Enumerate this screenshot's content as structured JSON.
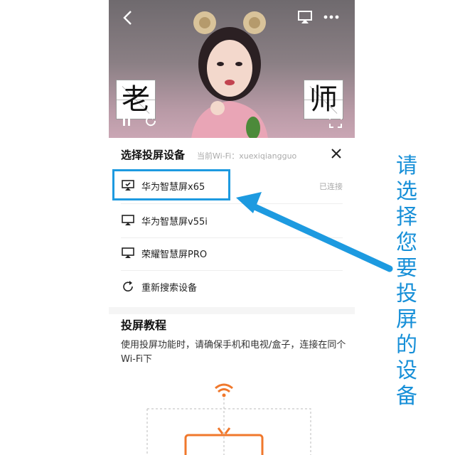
{
  "video": {
    "sticker_left": "老",
    "sticker_right": "师"
  },
  "panel": {
    "title": "选择投屏设备",
    "wifi_label": "当前Wi-Fi：xuexiqiangguo",
    "devices": [
      {
        "label": "华为智慧屏x65",
        "status": "已连接",
        "icon": "cast-connected-icon"
      },
      {
        "label": "华为智慧屏v55i",
        "status": "",
        "icon": "cast-icon"
      },
      {
        "label": "荣耀智慧屏PRO",
        "status": "",
        "icon": "cast-icon"
      },
      {
        "label": "重新搜索设备",
        "status": "",
        "icon": "refresh-icon"
      }
    ]
  },
  "tutorial": {
    "title": "投屏教程",
    "text": "使用投屏功能时，请确保手机和电视/盒子，连接在同个Wi-Fi下"
  },
  "annotation": {
    "side_text": "请选择您要投屏的设备",
    "color": "#1890d8"
  }
}
